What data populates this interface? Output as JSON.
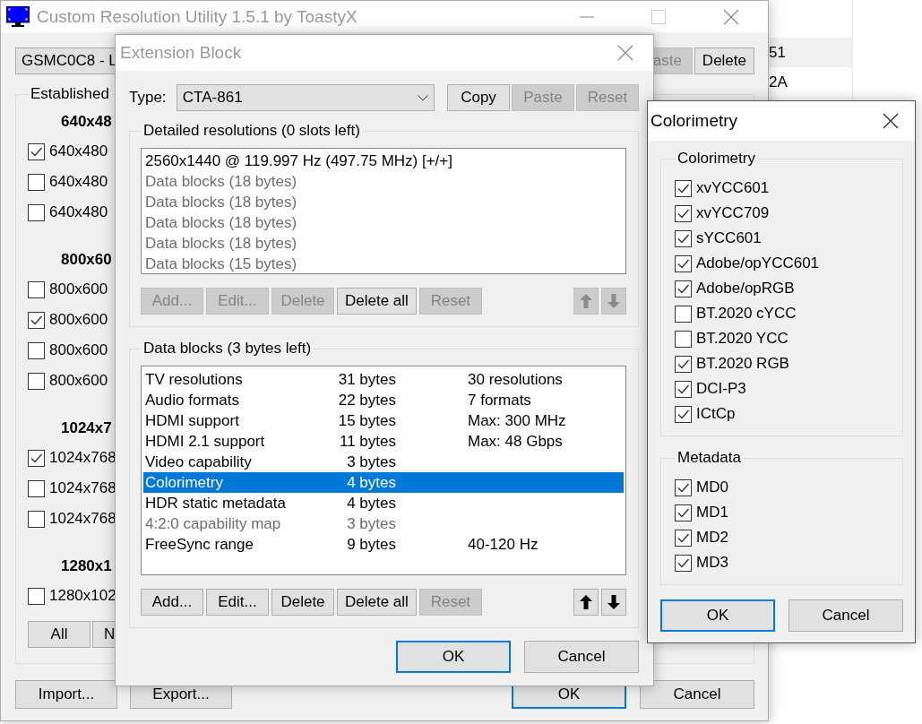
{
  "background_list": {
    "rows": [
      {
        "text": "51",
        "selected": true
      },
      {
        "text": "2A",
        "selected": false
      }
    ]
  },
  "main_window": {
    "title": "Custom Resolution Utility 1.5.1 by ToastyX",
    "active": false,
    "device": "GSMC0C8 - L",
    "top_buttons": [
      {
        "label": "aste",
        "disabled": true
      },
      {
        "label": "Delete",
        "disabled": false
      }
    ],
    "group": {
      "title": "Established",
      "sections": [
        {
          "heading": "640x48",
          "items": [
            {
              "label": "640x480",
              "checked": true
            },
            {
              "label": "640x480",
              "checked": false
            },
            {
              "label": "640x480",
              "checked": false
            }
          ]
        },
        {
          "heading": "800x60",
          "items": [
            {
              "label": "800x600",
              "checked": false
            },
            {
              "label": "800x600",
              "checked": true
            },
            {
              "label": "800x600",
              "checked": false
            },
            {
              "label": "800x600",
              "checked": false
            }
          ]
        },
        {
          "heading": "1024x7",
          "items": [
            {
              "label": "1024x768",
              "checked": true
            },
            {
              "label": "1024x768",
              "checked": false
            },
            {
              "label": "1024x768",
              "checked": false
            }
          ]
        },
        {
          "heading": "1280x1",
          "items": [
            {
              "label": "1280x102",
              "checked": false
            }
          ]
        }
      ],
      "buttons": [
        {
          "label": "All",
          "disabled": false
        },
        {
          "label": "N",
          "disabled": false
        }
      ]
    },
    "buttons": [
      {
        "label": "Import...",
        "disabled": false,
        "default": false
      },
      {
        "label": "Export...",
        "disabled": false,
        "default": false
      },
      {
        "label": "OK",
        "disabled": false,
        "default": true
      },
      {
        "label": "Cancel",
        "disabled": false,
        "default": false
      }
    ]
  },
  "extension_block": {
    "title": "Extension Block",
    "active": false,
    "type_label": "Type:",
    "type": "CTA-861",
    "type_buttons": [
      {
        "label": "Copy",
        "disabled": false
      },
      {
        "label": "Paste",
        "disabled": true
      },
      {
        "label": "Reset",
        "disabled": true
      }
    ],
    "detailed": {
      "title": "Detailed resolutions (0 slots left)",
      "items": [
        {
          "text": "2560x1440 @ 119.997 Hz (497.75 MHz) [+/+]",
          "disabled": false
        },
        {
          "text": "Data blocks (18 bytes)",
          "disabled": true
        },
        {
          "text": "Data blocks (18 bytes)",
          "disabled": true
        },
        {
          "text": "Data blocks (18 bytes)",
          "disabled": true
        },
        {
          "text": "Data blocks (18 bytes)",
          "disabled": true
        },
        {
          "text": "Data blocks (15 bytes)",
          "disabled": true
        }
      ],
      "buttons": [
        {
          "label": "Add...",
          "disabled": true
        },
        {
          "label": "Edit...",
          "disabled": true
        },
        {
          "label": "Delete",
          "disabled": true
        },
        {
          "label": "Delete all",
          "disabled": false
        },
        {
          "label": "Reset",
          "disabled": true
        }
      ],
      "arrows": [
        {
          "kind": "up",
          "disabled": true
        },
        {
          "kind": "down",
          "disabled": true
        }
      ]
    },
    "data_blocks": {
      "title": "Data blocks (3 bytes left)",
      "rows": [
        {
          "name": "TV resolutions",
          "size": "31 bytes",
          "info": "30 resolutions",
          "selected": false,
          "disabled": false
        },
        {
          "name": "Audio formats",
          "size": "22 bytes",
          "info": "7 formats",
          "selected": false,
          "disabled": false
        },
        {
          "name": "HDMI support",
          "size": "15 bytes",
          "info": "Max: 300 MHz",
          "selected": false,
          "disabled": false
        },
        {
          "name": "HDMI 2.1 support",
          "size": "11 bytes",
          "info": "Max: 48 Gbps",
          "selected": false,
          "disabled": false
        },
        {
          "name": "Video capability",
          "size": "3 bytes",
          "selected": false,
          "disabled": false
        },
        {
          "name": "Colorimetry",
          "size": "4 bytes",
          "selected": true,
          "disabled": false
        },
        {
          "name": "HDR static metadata",
          "size": "4 bytes",
          "selected": false,
          "disabled": false
        },
        {
          "name": "4:2:0 capability map",
          "size": "3 bytes",
          "selected": false,
          "disabled": true
        },
        {
          "name": "FreeSync range",
          "size": "9 bytes",
          "info": "40-120 Hz",
          "selected": false,
          "disabled": false
        }
      ],
      "buttons": [
        {
          "label": "Add...",
          "disabled": false
        },
        {
          "label": "Edit...",
          "disabled": false
        },
        {
          "label": "Delete",
          "disabled": false
        },
        {
          "label": "Delete all",
          "disabled": false
        },
        {
          "label": "Reset",
          "disabled": true
        }
      ],
      "arrows": [
        {
          "kind": "up",
          "disabled": false
        },
        {
          "kind": "down",
          "disabled": false
        }
      ]
    },
    "buttons": [
      {
        "label": "OK",
        "disabled": false,
        "default": true
      },
      {
        "label": "Cancel",
        "disabled": false,
        "default": false
      }
    ]
  },
  "colorimetry_dialog": {
    "title": "Colorimetry",
    "active": true,
    "groups": [
      {
        "title": "Colorimetry",
        "items": [
          {
            "label": "xvYCC601",
            "checked": true
          },
          {
            "label": "xvYCC709",
            "checked": true
          },
          {
            "label": "sYCC601",
            "checked": true
          },
          {
            "label": "Adobe/opYCC601",
            "checked": true
          },
          {
            "label": "Adobe/opRGB",
            "checked": true
          },
          {
            "label": "BT.2020 cYCC",
            "checked": false
          },
          {
            "label": "BT.2020 YCC",
            "checked": false
          },
          {
            "label": "BT.2020 RGB",
            "checked": true
          },
          {
            "label": "DCI-P3",
            "checked": true
          },
          {
            "label": "ICtCp",
            "checked": true
          }
        ]
      },
      {
        "title": "Metadata",
        "items": [
          {
            "label": "MD0",
            "checked": true
          },
          {
            "label": "MD1",
            "checked": true
          },
          {
            "label": "MD2",
            "checked": true
          },
          {
            "label": "MD3",
            "checked": true
          }
        ]
      }
    ],
    "buttons": [
      {
        "label": "OK",
        "disabled": false,
        "default": true
      },
      {
        "label": "Cancel",
        "disabled": false,
        "default": false
      }
    ]
  }
}
